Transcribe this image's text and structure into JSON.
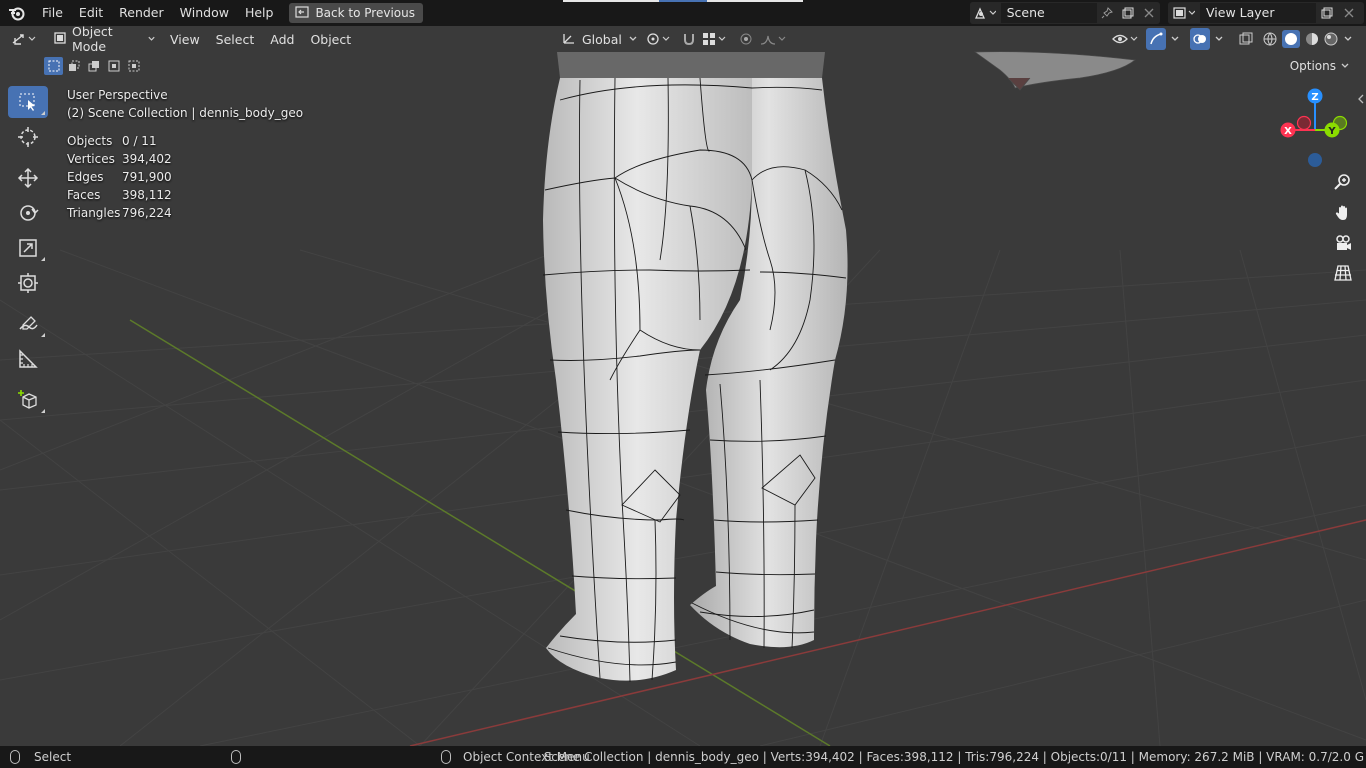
{
  "menubar": {
    "items": [
      "File",
      "Edit",
      "Render",
      "Window",
      "Help"
    ],
    "back_label": "Back to Previous",
    "scene_name": "Scene",
    "view_layer_name": "View Layer"
  },
  "header": {
    "mode_label": "Object Mode",
    "menus": [
      "View",
      "Select",
      "Add",
      "Object"
    ],
    "transform_orientation": "Global",
    "options_label": "Options"
  },
  "overlay": {
    "perspective": "User Perspective",
    "collection": "(2) Scene Collection | dennis_body_geo",
    "stats": [
      {
        "label": "Objects",
        "value": "0 / 11"
      },
      {
        "label": "Vertices",
        "value": "394,402"
      },
      {
        "label": "Edges",
        "value": "791,900"
      },
      {
        "label": "Faces",
        "value": "398,112"
      },
      {
        "label": "Triangles",
        "value": "796,224"
      }
    ]
  },
  "gizmo": {
    "z": "Z",
    "x": "X",
    "y": "Y"
  },
  "statusbar": {
    "left": "Select",
    "middle": "Object Context Menu",
    "right": "Scene Collection | dennis_body_geo | Verts:394,402 | Faces:398,112 | Tris:796,224 | Objects:0/11 | Memory: 267.2 MiB | VRAM: 0.7/2.0 G"
  },
  "colors": {
    "accent": "#4772b3",
    "axis_x": "#ff3352",
    "axis_y": "#8bdc00",
    "axis_z": "#2890ff",
    "viewport_bg": "#303030"
  }
}
